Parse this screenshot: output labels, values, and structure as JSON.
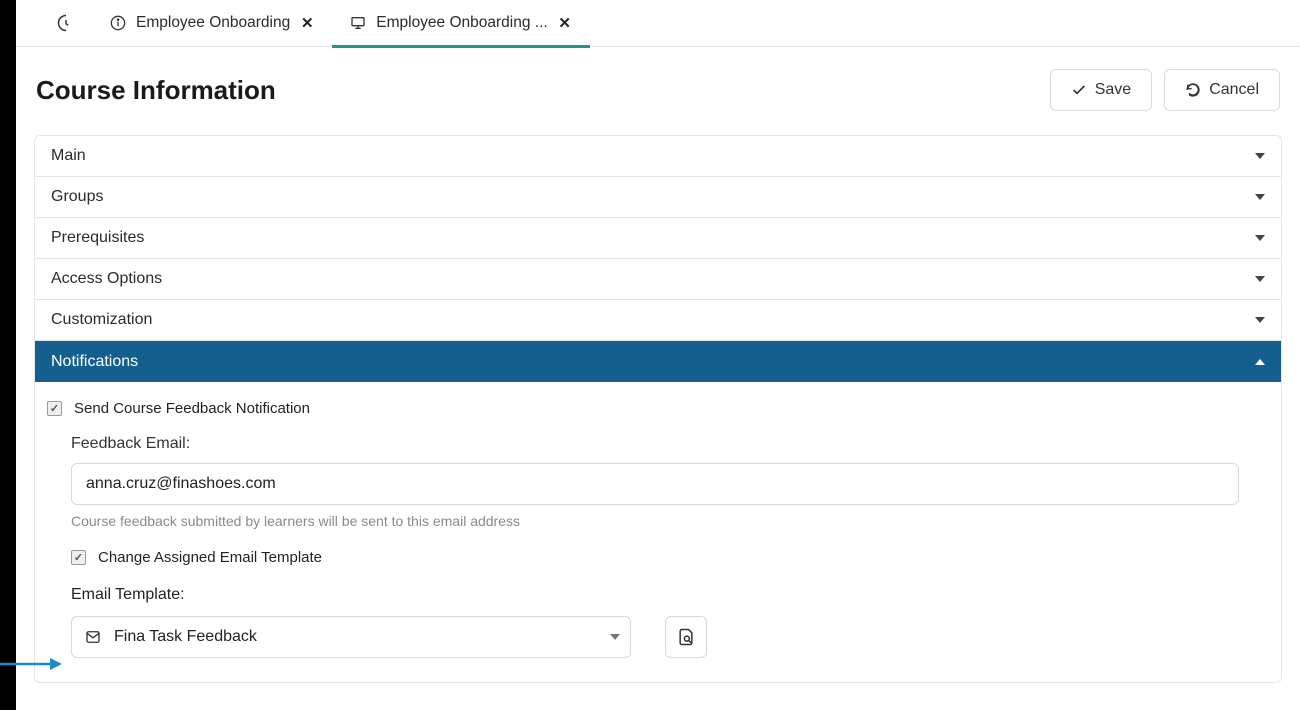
{
  "tabs": {
    "tab1": {
      "label": "Employee Onboarding"
    },
    "tab2": {
      "label": "Employee Onboarding ..."
    }
  },
  "header": {
    "title": "Course Information",
    "save_label": "Save",
    "cancel_label": "Cancel"
  },
  "accordion": {
    "main": "Main",
    "groups": "Groups",
    "prereq": "Prerequisites",
    "access": "Access Options",
    "custom": "Customization",
    "notifications": "Notifications"
  },
  "notifications": {
    "send_feedback_label": "Send Course Feedback Notification",
    "feedback_email_label": "Feedback Email:",
    "feedback_email_value": "anna.cruz@finashoes.com",
    "feedback_help": "Course feedback submitted by learners will be sent to this email address",
    "change_template_label": "Change Assigned Email Template",
    "email_template_label": "Email Template:",
    "email_template_value": "Fina Task Feedback"
  }
}
